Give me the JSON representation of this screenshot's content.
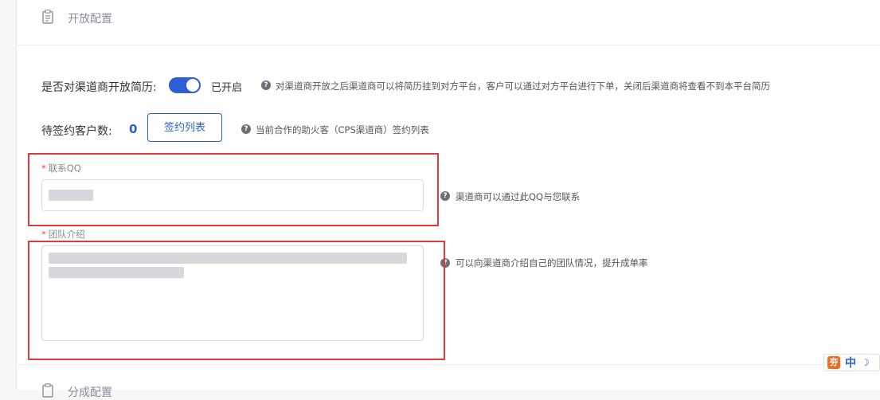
{
  "section": {
    "title": "开放配置",
    "icon": "clipboard-icon"
  },
  "open_resume": {
    "label": "是否对渠道商开放简历:",
    "toggle_on": true,
    "toggle_text": "已开启",
    "hint": "对渠道商开放之后渠道商可以将简历挂到对方平台，客户可以通过对方平台进行下单，关闭后渠道商将查看不到本平台简历"
  },
  "pending": {
    "label": "待签约客户数:",
    "count": "0",
    "button": "签约列表",
    "hint": "当前合作的助火客（CPS渠道商）签约列表"
  },
  "qq": {
    "required_mark": "*",
    "label": "联系QQ",
    "value": "",
    "hint": "渠道商可以通过此QQ与您联系"
  },
  "team": {
    "required_mark": "*",
    "label": "团队介绍",
    "value": "",
    "hint": "可以向渠道商介绍自己的团队情况，提升成单率"
  },
  "next_section": {
    "title": "分成配置"
  },
  "ime": {
    "logo": "夯",
    "mode": "中",
    "moon": "☽"
  },
  "colors": {
    "accent": "#2c5fd6",
    "highlight": "#e03a3a",
    "required": "#e5484d"
  }
}
